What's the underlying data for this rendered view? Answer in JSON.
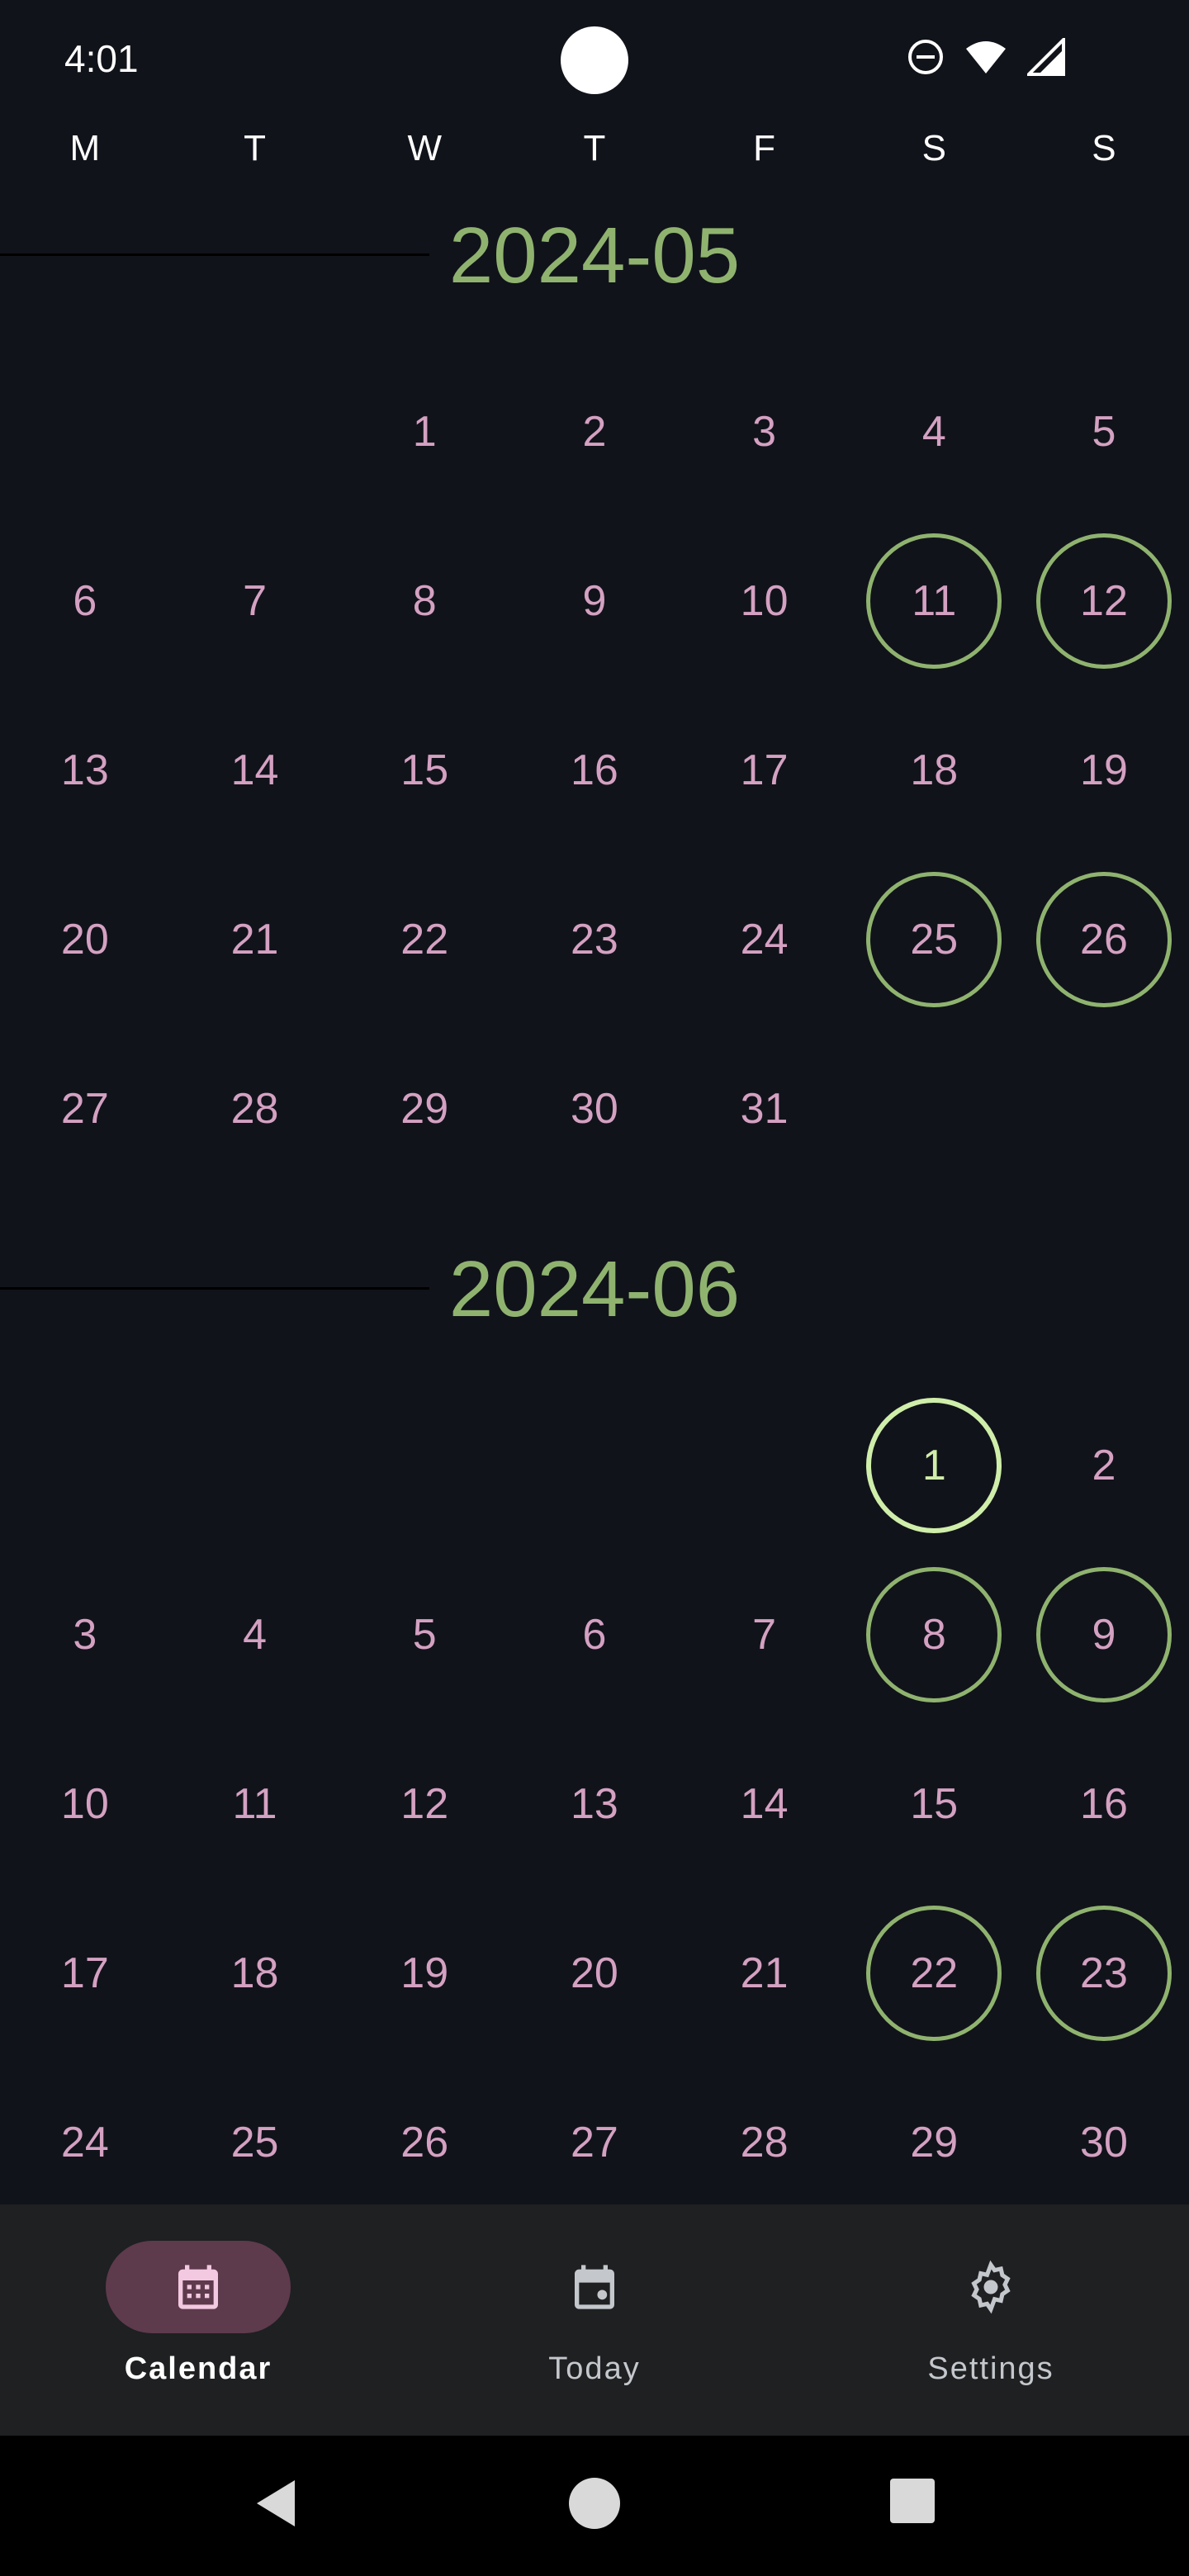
{
  "status_bar": {
    "time": "4:01"
  },
  "weekdays": [
    "M",
    "T",
    "W",
    "T",
    "F",
    "S",
    "S"
  ],
  "months": [
    {
      "title": "2024-05",
      "leading_blanks": 2,
      "days": [
        {
          "n": "1"
        },
        {
          "n": "2"
        },
        {
          "n": "3"
        },
        {
          "n": "4"
        },
        {
          "n": "5"
        },
        {
          "n": "6"
        },
        {
          "n": "7"
        },
        {
          "n": "8"
        },
        {
          "n": "9"
        },
        {
          "n": "10"
        },
        {
          "n": "11",
          "marked": true
        },
        {
          "n": "12",
          "marked": true
        },
        {
          "n": "13"
        },
        {
          "n": "14"
        },
        {
          "n": "15"
        },
        {
          "n": "16"
        },
        {
          "n": "17"
        },
        {
          "n": "18"
        },
        {
          "n": "19"
        },
        {
          "n": "20"
        },
        {
          "n": "21"
        },
        {
          "n": "22"
        },
        {
          "n": "23"
        },
        {
          "n": "24"
        },
        {
          "n": "25",
          "marked": true
        },
        {
          "n": "26",
          "marked": true
        },
        {
          "n": "27"
        },
        {
          "n": "28"
        },
        {
          "n": "29"
        },
        {
          "n": "30"
        },
        {
          "n": "31"
        }
      ]
    },
    {
      "title": "2024-06",
      "leading_blanks": 5,
      "days": [
        {
          "n": "1",
          "today": true
        },
        {
          "n": "2"
        },
        {
          "n": "3"
        },
        {
          "n": "4"
        },
        {
          "n": "5"
        },
        {
          "n": "6"
        },
        {
          "n": "7"
        },
        {
          "n": "8",
          "marked": true
        },
        {
          "n": "9",
          "marked": true
        },
        {
          "n": "10"
        },
        {
          "n": "11"
        },
        {
          "n": "12"
        },
        {
          "n": "13"
        },
        {
          "n": "14"
        },
        {
          "n": "15"
        },
        {
          "n": "16"
        },
        {
          "n": "17"
        },
        {
          "n": "18"
        },
        {
          "n": "19"
        },
        {
          "n": "20"
        },
        {
          "n": "21"
        },
        {
          "n": "22",
          "marked": true
        },
        {
          "n": "23",
          "marked": true
        },
        {
          "n": "24"
        },
        {
          "n": "25"
        },
        {
          "n": "26"
        },
        {
          "n": "27"
        },
        {
          "n": "28"
        },
        {
          "n": "29"
        },
        {
          "n": "30"
        }
      ]
    }
  ],
  "bottom_nav": {
    "items": [
      {
        "label": "Calendar",
        "icon": "calendar-icon",
        "active": true
      },
      {
        "label": "Today",
        "icon": "calendar-today-icon",
        "active": false
      },
      {
        "label": "Settings",
        "icon": "gear-icon",
        "active": false
      }
    ]
  },
  "colors": {
    "background": "#11131a",
    "accent_green": "#8fb36f",
    "today_ring": "#cfeeaa",
    "day_text": "#d4a1c2",
    "nav_active_pill": "#5e3a4d"
  }
}
